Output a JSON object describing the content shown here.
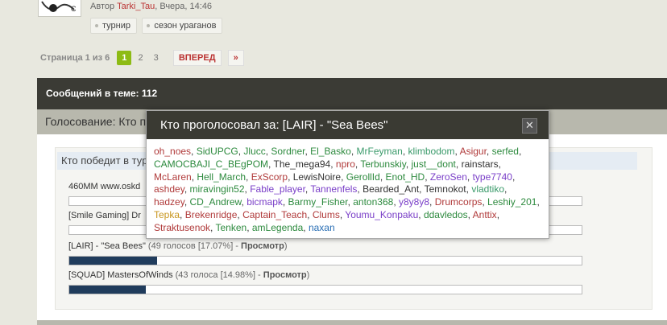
{
  "author": {
    "prefix": "Автор",
    "name": "Tarki_Tau",
    "sep": ",",
    "time": "Вчера, 14:46"
  },
  "tags": [
    "турнир",
    "сезон ураганов"
  ],
  "pagination": {
    "info": "Страница 1 из 6",
    "pages": [
      "1",
      "2",
      "3"
    ],
    "current": "1",
    "next_label": "ВПЕРЕД",
    "last_label": "»"
  },
  "topic": {
    "messages_label": "Сообщений в теме: 112"
  },
  "poll": {
    "title": "Голосование: Кто п",
    "question": "Кто победит в тур",
    "options": [
      {
        "label": "460MM www.oskd",
        "votes": "",
        "view": "",
        "fraction": 0
      },
      {
        "label": "[Smile Gaming] Dr",
        "votes": "",
        "view": "",
        "fraction": 0
      },
      {
        "label": "[LAIR] - \"Sea Bees\"",
        "votes": "(49 голосов [17.07%] -",
        "view": "Просмотр",
        "fraction": 0.1707
      },
      {
        "label": "[SQUAD] MastersOfWinds",
        "votes": "(43 голоса [14.98%] -",
        "view": "Просмотр",
        "fraction": 0.1498
      }
    ]
  },
  "modal": {
    "title": "Кто проголосовал за: [LAIR] - \"Sea Bees\"",
    "close_label": "✕",
    "voters": [
      {
        "name": "oh_noes",
        "color": "#b03a3a"
      },
      {
        "name": "SidUPCG",
        "color": "#2d8a3e"
      },
      {
        "name": "Jlucc",
        "color": "#2d8a3e"
      },
      {
        "name": "Sordner",
        "color": "#2d8a3e"
      },
      {
        "name": "El_Basko",
        "color": "#2d8a3e"
      },
      {
        "name": "MrFeyman",
        "color": "#3a9a6a"
      },
      {
        "name": "klimbodom",
        "color": "#3a9a6a"
      },
      {
        "name": "Asigur",
        "color": "#b03a3a"
      },
      {
        "name": "serfed",
        "color": "#2d8a3e"
      },
      {
        "name": "CAMOCBAJI_C_BEgPOM",
        "color": "#2d8a3e"
      },
      {
        "name": "The_mega94",
        "color": "#333333"
      },
      {
        "name": "npro",
        "color": "#b03a3a"
      },
      {
        "name": "Terbunskiy",
        "color": "#2d8a3e"
      },
      {
        "name": "just__dont",
        "color": "#2d8a3e"
      },
      {
        "name": "rainstars",
        "color": "#333333"
      },
      {
        "name": "McLaren",
        "color": "#b03a3a"
      },
      {
        "name": "Hell_March",
        "color": "#2d8a3e"
      },
      {
        "name": "ExScorp",
        "color": "#b03a3a"
      },
      {
        "name": "LewisNoire",
        "color": "#333333"
      },
      {
        "name": "GerollId",
        "color": "#2d8a3e"
      },
      {
        "name": "Enot_HD",
        "color": "#2d8a3e"
      },
      {
        "name": "ZeroSen",
        "color": "#7a3fc8"
      },
      {
        "name": "type7740",
        "color": "#7a3fc8"
      },
      {
        "name": "ashdey",
        "color": "#b03a3a"
      },
      {
        "name": "miravingin52",
        "color": "#2d8a3e"
      },
      {
        "name": "Fable_player",
        "color": "#7a3fc8"
      },
      {
        "name": "Tannenfels",
        "color": "#7a3fc8"
      },
      {
        "name": "Bearded_Ant",
        "color": "#333333"
      },
      {
        "name": "Temnokot",
        "color": "#333333"
      },
      {
        "name": "vladtiko",
        "color": "#3a9a6a"
      },
      {
        "name": "hadzey",
        "color": "#b03a3a"
      },
      {
        "name": "CD_Andrew",
        "color": "#2d8a3e"
      },
      {
        "name": "bicmapk",
        "color": "#7a3fc8"
      },
      {
        "name": "Barmy_Fisher",
        "color": "#2d8a3e"
      },
      {
        "name": "anton368",
        "color": "#2d8a3e"
      },
      {
        "name": "y8y8y8",
        "color": "#7a3fc8"
      },
      {
        "name": "Drumcorps",
        "color": "#b03a3a"
      },
      {
        "name": "Leshiy_201",
        "color": "#2d8a3e"
      },
      {
        "name": "Tepka",
        "color": "#c8961e"
      },
      {
        "name": "Brekenridge",
        "color": "#b03a3a"
      },
      {
        "name": "Captain_Teach",
        "color": "#b03a3a"
      },
      {
        "name": "Clums",
        "color": "#b03a3a"
      },
      {
        "name": "Youmu_Konpaku",
        "color": "#7a3fc8"
      },
      {
        "name": "ddavledos",
        "color": "#2d8a3e"
      },
      {
        "name": "Anttix",
        "color": "#b03a3a"
      },
      {
        "name": "Straktusenok",
        "color": "#b03a3a"
      },
      {
        "name": "Tenken",
        "color": "#2d8a3e"
      },
      {
        "name": "amLegenda",
        "color": "#2d8a3e"
      },
      {
        "name": "naxan",
        "color": "#2a6fb5"
      }
    ]
  }
}
